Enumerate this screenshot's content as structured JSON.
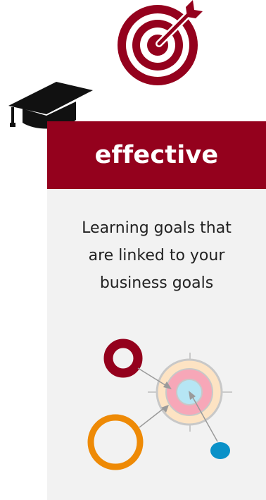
{
  "card": {
    "title": "effective",
    "description_lines": [
      "Learning goals that",
      "are linked to your",
      "business goals"
    ]
  },
  "icons": {
    "top": "bullseye-target-with-arrow-icon",
    "left": "graduation-cap-icon",
    "illustration": "target-with-circles-and-arrows"
  },
  "colors": {
    "brand_red": "#94011d",
    "card_background": "#f2f2f2",
    "orange": "#ee8a06",
    "blue": "#0a91c8",
    "pink": "#f7a7b8",
    "peach": "#fde3c3",
    "light_blue": "#b6e6f4"
  }
}
